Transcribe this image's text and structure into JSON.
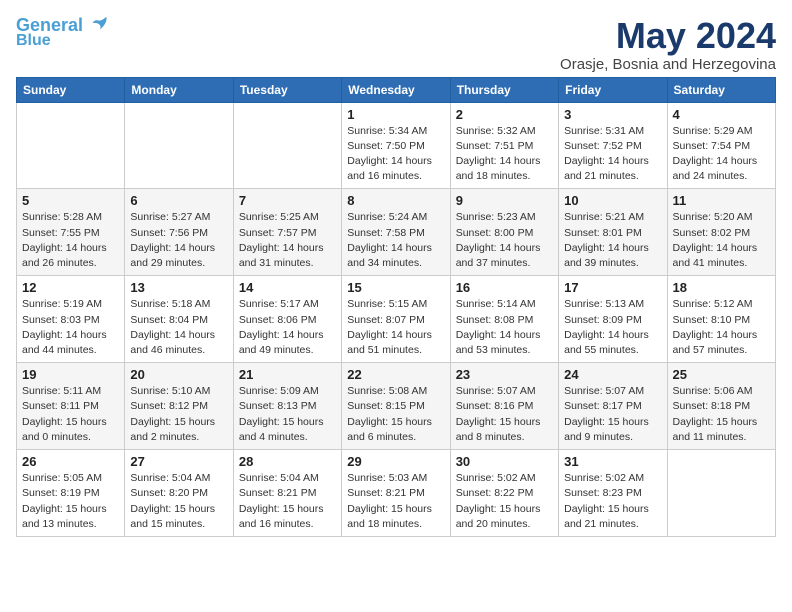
{
  "header": {
    "logo_line1": "General",
    "logo_line2": "Blue",
    "month_title": "May 2024",
    "location": "Orasje, Bosnia and Herzegovina"
  },
  "weekdays": [
    "Sunday",
    "Monday",
    "Tuesday",
    "Wednesday",
    "Thursday",
    "Friday",
    "Saturday"
  ],
  "weeks": [
    [
      {
        "day": "",
        "info": ""
      },
      {
        "day": "",
        "info": ""
      },
      {
        "day": "",
        "info": ""
      },
      {
        "day": "1",
        "info": "Sunrise: 5:34 AM\nSunset: 7:50 PM\nDaylight: 14 hours\nand 16 minutes."
      },
      {
        "day": "2",
        "info": "Sunrise: 5:32 AM\nSunset: 7:51 PM\nDaylight: 14 hours\nand 18 minutes."
      },
      {
        "day": "3",
        "info": "Sunrise: 5:31 AM\nSunset: 7:52 PM\nDaylight: 14 hours\nand 21 minutes."
      },
      {
        "day": "4",
        "info": "Sunrise: 5:29 AM\nSunset: 7:54 PM\nDaylight: 14 hours\nand 24 minutes."
      }
    ],
    [
      {
        "day": "5",
        "info": "Sunrise: 5:28 AM\nSunset: 7:55 PM\nDaylight: 14 hours\nand 26 minutes."
      },
      {
        "day": "6",
        "info": "Sunrise: 5:27 AM\nSunset: 7:56 PM\nDaylight: 14 hours\nand 29 minutes."
      },
      {
        "day": "7",
        "info": "Sunrise: 5:25 AM\nSunset: 7:57 PM\nDaylight: 14 hours\nand 31 minutes."
      },
      {
        "day": "8",
        "info": "Sunrise: 5:24 AM\nSunset: 7:58 PM\nDaylight: 14 hours\nand 34 minutes."
      },
      {
        "day": "9",
        "info": "Sunrise: 5:23 AM\nSunset: 8:00 PM\nDaylight: 14 hours\nand 37 minutes."
      },
      {
        "day": "10",
        "info": "Sunrise: 5:21 AM\nSunset: 8:01 PM\nDaylight: 14 hours\nand 39 minutes."
      },
      {
        "day": "11",
        "info": "Sunrise: 5:20 AM\nSunset: 8:02 PM\nDaylight: 14 hours\nand 41 minutes."
      }
    ],
    [
      {
        "day": "12",
        "info": "Sunrise: 5:19 AM\nSunset: 8:03 PM\nDaylight: 14 hours\nand 44 minutes."
      },
      {
        "day": "13",
        "info": "Sunrise: 5:18 AM\nSunset: 8:04 PM\nDaylight: 14 hours\nand 46 minutes."
      },
      {
        "day": "14",
        "info": "Sunrise: 5:17 AM\nSunset: 8:06 PM\nDaylight: 14 hours\nand 49 minutes."
      },
      {
        "day": "15",
        "info": "Sunrise: 5:15 AM\nSunset: 8:07 PM\nDaylight: 14 hours\nand 51 minutes."
      },
      {
        "day": "16",
        "info": "Sunrise: 5:14 AM\nSunset: 8:08 PM\nDaylight: 14 hours\nand 53 minutes."
      },
      {
        "day": "17",
        "info": "Sunrise: 5:13 AM\nSunset: 8:09 PM\nDaylight: 14 hours\nand 55 minutes."
      },
      {
        "day": "18",
        "info": "Sunrise: 5:12 AM\nSunset: 8:10 PM\nDaylight: 14 hours\nand 57 minutes."
      }
    ],
    [
      {
        "day": "19",
        "info": "Sunrise: 5:11 AM\nSunset: 8:11 PM\nDaylight: 15 hours\nand 0 minutes."
      },
      {
        "day": "20",
        "info": "Sunrise: 5:10 AM\nSunset: 8:12 PM\nDaylight: 15 hours\nand 2 minutes."
      },
      {
        "day": "21",
        "info": "Sunrise: 5:09 AM\nSunset: 8:13 PM\nDaylight: 15 hours\nand 4 minutes."
      },
      {
        "day": "22",
        "info": "Sunrise: 5:08 AM\nSunset: 8:15 PM\nDaylight: 15 hours\nand 6 minutes."
      },
      {
        "day": "23",
        "info": "Sunrise: 5:07 AM\nSunset: 8:16 PM\nDaylight: 15 hours\nand 8 minutes."
      },
      {
        "day": "24",
        "info": "Sunrise: 5:07 AM\nSunset: 8:17 PM\nDaylight: 15 hours\nand 9 minutes."
      },
      {
        "day": "25",
        "info": "Sunrise: 5:06 AM\nSunset: 8:18 PM\nDaylight: 15 hours\nand 11 minutes."
      }
    ],
    [
      {
        "day": "26",
        "info": "Sunrise: 5:05 AM\nSunset: 8:19 PM\nDaylight: 15 hours\nand 13 minutes."
      },
      {
        "day": "27",
        "info": "Sunrise: 5:04 AM\nSunset: 8:20 PM\nDaylight: 15 hours\nand 15 minutes."
      },
      {
        "day": "28",
        "info": "Sunrise: 5:04 AM\nSunset: 8:21 PM\nDaylight: 15 hours\nand 16 minutes."
      },
      {
        "day": "29",
        "info": "Sunrise: 5:03 AM\nSunset: 8:21 PM\nDaylight: 15 hours\nand 18 minutes."
      },
      {
        "day": "30",
        "info": "Sunrise: 5:02 AM\nSunset: 8:22 PM\nDaylight: 15 hours\nand 20 minutes."
      },
      {
        "day": "31",
        "info": "Sunrise: 5:02 AM\nSunset: 8:23 PM\nDaylight: 15 hours\nand 21 minutes."
      },
      {
        "day": "",
        "info": ""
      }
    ]
  ]
}
